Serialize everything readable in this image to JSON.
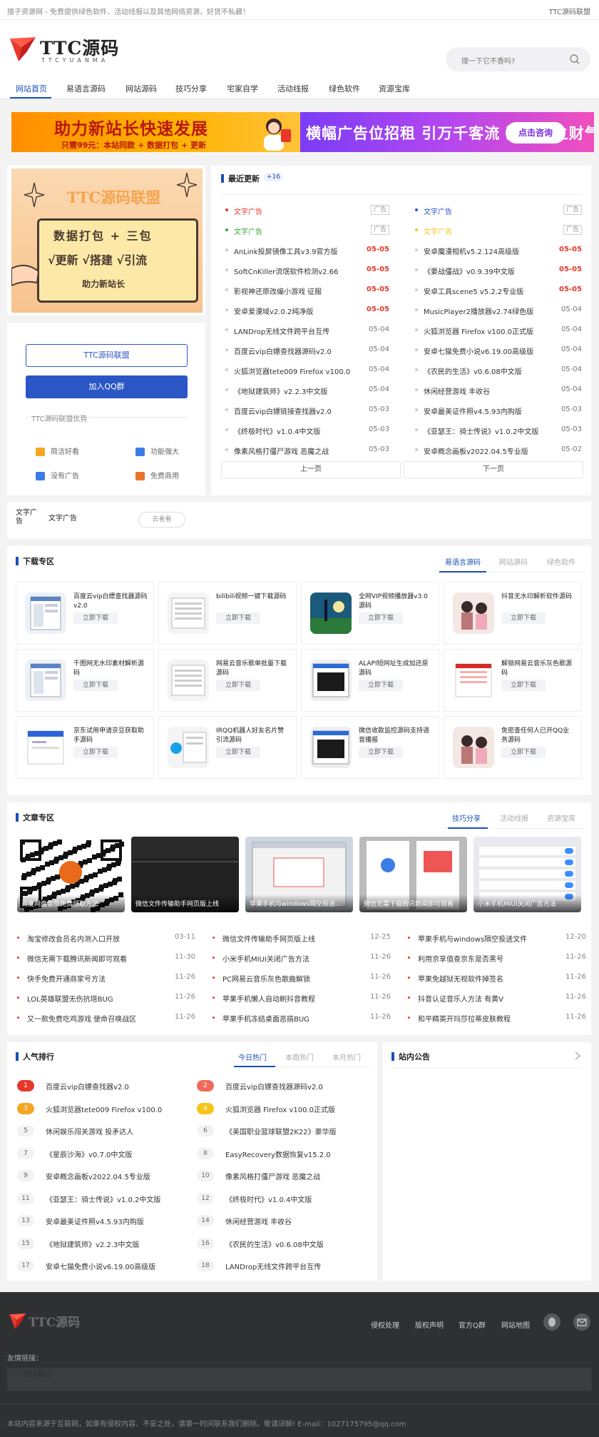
{
  "topbar": {
    "left": "搜子资源网 - 免费提供绿色软件、活动线报以及其他网络资源，好货不私藏！",
    "right": "TTC源码联盟"
  },
  "header": {
    "logo_text": "TTC源码",
    "logo_sub": "TTCYUANMA",
    "search_placeholder": "搜一下它不香吗?"
  },
  "nav": [
    "网站首页",
    "易语言源码",
    "网站源码",
    "技巧分享",
    "宅家自学",
    "活动线报",
    "绿色软件",
    "资源宝库"
  ],
  "banner1": {
    "title": "助力新站长快速发展",
    "sub": "只需99元：本站同款 + 数据打包 + 更新"
  },
  "banner2": {
    "title": "横幅广告位招租 引万千客流 聚八方之财气",
    "button": "点击咨询"
  },
  "promo": {
    "title": "TTC源码联盟",
    "line1": "数据打包 + 三包",
    "line2": "√更新 √搭建 √引流",
    "line3": "助力新站长"
  },
  "union": {
    "btn1": "TTC源码联盟",
    "btn2": "加入QQ群",
    "adv_title": "TTC源码联盟优势",
    "features": [
      {
        "label": "简洁好看",
        "color": "#f5a623"
      },
      {
        "label": "功能强大",
        "color": "#3b7de8"
      },
      {
        "label": "没有广告",
        "color": "#3b7de8"
      },
      {
        "label": "免费商用",
        "color": "#e8732c"
      }
    ]
  },
  "updates": {
    "title": "最近更新",
    "count": "+16",
    "ads": [
      {
        "text": "文字广告",
        "color": "#e8382c",
        "tag": "广告"
      },
      {
        "text": "文字广告",
        "color": "#2b56c6",
        "tag": "广告"
      },
      {
        "text": "文字广告",
        "color": "#3aa53a",
        "tag": "广告"
      },
      {
        "text": "文字广告",
        "color": "#f5c518",
        "tag": "广告"
      }
    ],
    "left": [
      {
        "text": "AnLink投屏镜像工具v3.9官方版",
        "date": "05-05",
        "red": true
      },
      {
        "text": "SoftCnKiller流氓软件检测v2.66",
        "date": "05-05",
        "red": true
      },
      {
        "text": "影视神还原改编小游戏 征服",
        "date": "05-05",
        "red": true
      },
      {
        "text": "安卓爱漫域v2.0.2纯净版",
        "date": "05-05",
        "red": true
      },
      {
        "text": "LANDrop无线文件跨平台互传",
        "date": "05-04",
        "red": false
      },
      {
        "text": "百度云vip白嫖查找器源码v2.0",
        "date": "05-04",
        "red": false
      },
      {
        "text": "火狐浏览器tete009 Firefox v100.0",
        "date": "05-04",
        "red": false
      },
      {
        "text": "《地狱建筑师》v2.2.3中文版",
        "date": "05-04",
        "red": false
      },
      {
        "text": "百度云vip白嫖链接查找器v2.0",
        "date": "05-03",
        "red": false
      },
      {
        "text": "《终极时代》v1.0.4中文版",
        "date": "05-03",
        "red": false
      },
      {
        "text": "像素风格打僵尸游戏 恶魔之战",
        "date": "05-03",
        "red": false
      }
    ],
    "right": [
      {
        "text": "安卓魔漫相机v5.2.124高级版",
        "date": "05-05",
        "red": true
      },
      {
        "text": "《要战僵战》v0.9.39中文版",
        "date": "05-05",
        "red": true
      },
      {
        "text": "安卓工具scene5 v5.2.2专业版",
        "date": "05-05",
        "red": true
      },
      {
        "text": "MusicPlayer2播放器v2.74绿色版",
        "date": "05-04",
        "red": false
      },
      {
        "text": "火狐浏览器 Firefox v100.0正式版",
        "date": "05-04",
        "red": false
      },
      {
        "text": "安卓七猫免费小说v6.19.00高级版",
        "date": "05-04",
        "red": false
      },
      {
        "text": "《农民的生活》v0.6.08中文版",
        "date": "05-04",
        "red": false
      },
      {
        "text": "休闲经营游戏 丰收谷",
        "date": "05-04",
        "red": false
      },
      {
        "text": "安卓最美证件照v4.5.93内购版",
        "date": "05-03",
        "red": false
      },
      {
        "text": "《亚瑟王：骑士传说》v1.0.2中文版",
        "date": "05-03",
        "red": false
      },
      {
        "text": "安卓概念画板v2022.04.5专业版",
        "date": "05-02",
        "red": false
      }
    ],
    "prev": "上一页",
    "next": "下一页"
  },
  "adstrip": {
    "label": "文字广告",
    "text": "文字广告",
    "button": "去看看"
  },
  "download": {
    "title": "下载专区",
    "tabs": [
      "易语言源码",
      "网站源码",
      "绿色软件"
    ],
    "btn": "立即下载",
    "items": [
      {
        "name": "百度云vip白嫖查找器源码v2.0",
        "thumb": "win"
      },
      {
        "name": "bilibili视频一键下载源码",
        "thumb": "list"
      },
      {
        "name": "全网VIP视频播放器v3.0源码",
        "thumb": "photo"
      },
      {
        "name": "抖音无水印解析软件源码",
        "thumb": "people"
      },
      {
        "name": "千图网无水印素材解析源码",
        "thumb": "win"
      },
      {
        "name": "网易云音乐歌单批量下载源码",
        "thumb": "list"
      },
      {
        "name": "ALAPI短网址生成加还原源码",
        "thumb": "dark"
      },
      {
        "name": "解锁网易云音乐灰色歌源码",
        "thumb": "red"
      },
      {
        "name": "京东试用申请京豆获取助手源码",
        "thumb": "blue"
      },
      {
        "name": "IRQQ机器人好友名片赞引流源码",
        "thumb": "qq"
      },
      {
        "name": "微信收款监控源码支持语音播报",
        "thumb": "dark"
      },
      {
        "name": "免密查任何人已开QQ业务源码",
        "thumb": "people"
      }
    ]
  },
  "articles": {
    "title": "文章专区",
    "tabs": [
      "技巧分享",
      "活动线报",
      "资源宝库"
    ],
    "cards": [
      {
        "caption": "百度网盘会员免费领取方法",
        "style": "qr"
      },
      {
        "caption": "微信文件传输助手网页版上线",
        "style": "darkcard"
      },
      {
        "caption": "苹果手机与windows隔空投送...",
        "style": "screen"
      },
      {
        "caption": "微信无需下载腾讯新闻即可观看",
        "style": "phone"
      },
      {
        "caption": "小米手机MIUI关闭广告方法",
        "style": "settings"
      }
    ],
    "cols": [
      [
        {
          "text": "淘宝修改会员名内测入口开放",
          "date": "03-11"
        },
        {
          "text": "微信无需下载腾讯新闻即可观看",
          "date": "11-30"
        },
        {
          "text": "快手免费开通商家号方法",
          "date": "11-26"
        },
        {
          "text": "LOL英雄联盟无伤抗塔BUG",
          "date": "11-26"
        },
        {
          "text": "又一款免费吃鸡游戏 使命召唤战区",
          "date": "11-26"
        }
      ],
      [
        {
          "text": "微信文件传输助手网页版上线",
          "date": "12-25"
        },
        {
          "text": "小米手机MIUI关闭广告方法",
          "date": "11-26"
        },
        {
          "text": "PC网易云音乐灰色歌曲解锁",
          "date": "11-26"
        },
        {
          "text": "苹果手机懒人自动刷抖音教程",
          "date": "11-26"
        },
        {
          "text": "苹果手机冻结桌面恶搞BUG",
          "date": "11-26"
        }
      ],
      [
        {
          "text": "苹果手机与windows隔空投送文件",
          "date": "12-20"
        },
        {
          "text": "利用京享值查京东是否黑号",
          "date": "11-26"
        },
        {
          "text": "苹果免越狱无视软件掉签名",
          "date": "11-26"
        },
        {
          "text": "抖音认证音乐人方法 有黄V",
          "date": "11-26"
        },
        {
          "text": "和平精英开玛莎拉蒂皮肤教程",
          "date": "11-26"
        }
      ]
    ]
  },
  "rank": {
    "title": "人气排行",
    "tabs": [
      "今日热门",
      "本周热门",
      "本月热门"
    ],
    "left": [
      {
        "n": "1",
        "text": "百度云vip白嫖查找器v2.0",
        "bg": "#e8382c",
        "fg": "#fff"
      },
      {
        "n": "3",
        "text": "火狐浏览器tete009 Firefox v100.0",
        "bg": "#f5a623",
        "fg": "#fff"
      },
      {
        "n": "5",
        "text": "休闲娱乐闯关游戏 投矛达人",
        "bg": "",
        "fg": ""
      },
      {
        "n": "7",
        "text": "《星辰沙海》v0.7.0中文版",
        "bg": "",
        "fg": ""
      },
      {
        "n": "9",
        "text": "安卓概念画板v2022.04.5专业版",
        "bg": "",
        "fg": ""
      },
      {
        "n": "11",
        "text": "《亚瑟王：骑士传说》v1.0.2中文版",
        "bg": "",
        "fg": ""
      },
      {
        "n": "13",
        "text": "安卓最美证件照v4.5.93内购版",
        "bg": "",
        "fg": ""
      },
      {
        "n": "15",
        "text": "《地狱建筑师》v2.2.3中文版",
        "bg": "",
        "fg": ""
      },
      {
        "n": "17",
        "text": "安卓七猫免费小说v6.19.00高级版",
        "bg": "",
        "fg": ""
      }
    ],
    "right": [
      {
        "n": "2",
        "text": "百度云vip白嫖查找器源码v2.0",
        "bg": "#f06a5b",
        "fg": "#fff"
      },
      {
        "n": "4",
        "text": "火狐浏览器 Firefox v100.0正式版",
        "bg": "#f5c518",
        "fg": "#fff"
      },
      {
        "n": "6",
        "text": "《美国职业篮球联盟2K22》豪华版",
        "bg": "",
        "fg": ""
      },
      {
        "n": "8",
        "text": "EasyRecovery数据恢复v15.2.0",
        "bg": "",
        "fg": ""
      },
      {
        "n": "10",
        "text": "像素风格打僵尸游戏 恶魔之战",
        "bg": "",
        "fg": ""
      },
      {
        "n": "12",
        "text": "《终极时代》v1.0.4中文版",
        "bg": "",
        "fg": ""
      },
      {
        "n": "14",
        "text": "休闲经营游戏 丰收谷",
        "bg": "",
        "fg": ""
      },
      {
        "n": "16",
        "text": "《农民的生活》v0.6.08中文版",
        "bg": "",
        "fg": ""
      },
      {
        "n": "18",
        "text": "LANDrop无线文件跨平台互传",
        "bg": "",
        "fg": ""
      }
    ]
  },
  "notice": {
    "title": "站内公告"
  },
  "footer": {
    "logo": "TTC源码",
    "links": [
      "侵权处理",
      "版权声明",
      "官方Q群",
      "网站地图"
    ],
    "friend_label": "友情链接：",
    "friend": "TTC源码联盟",
    "copyright": "本站内容来源于互联网，如果有侵权内容、不妥之处，请第一时间联系我们删除。敬请谅解! E-mail：1027175795@qq.com"
  }
}
